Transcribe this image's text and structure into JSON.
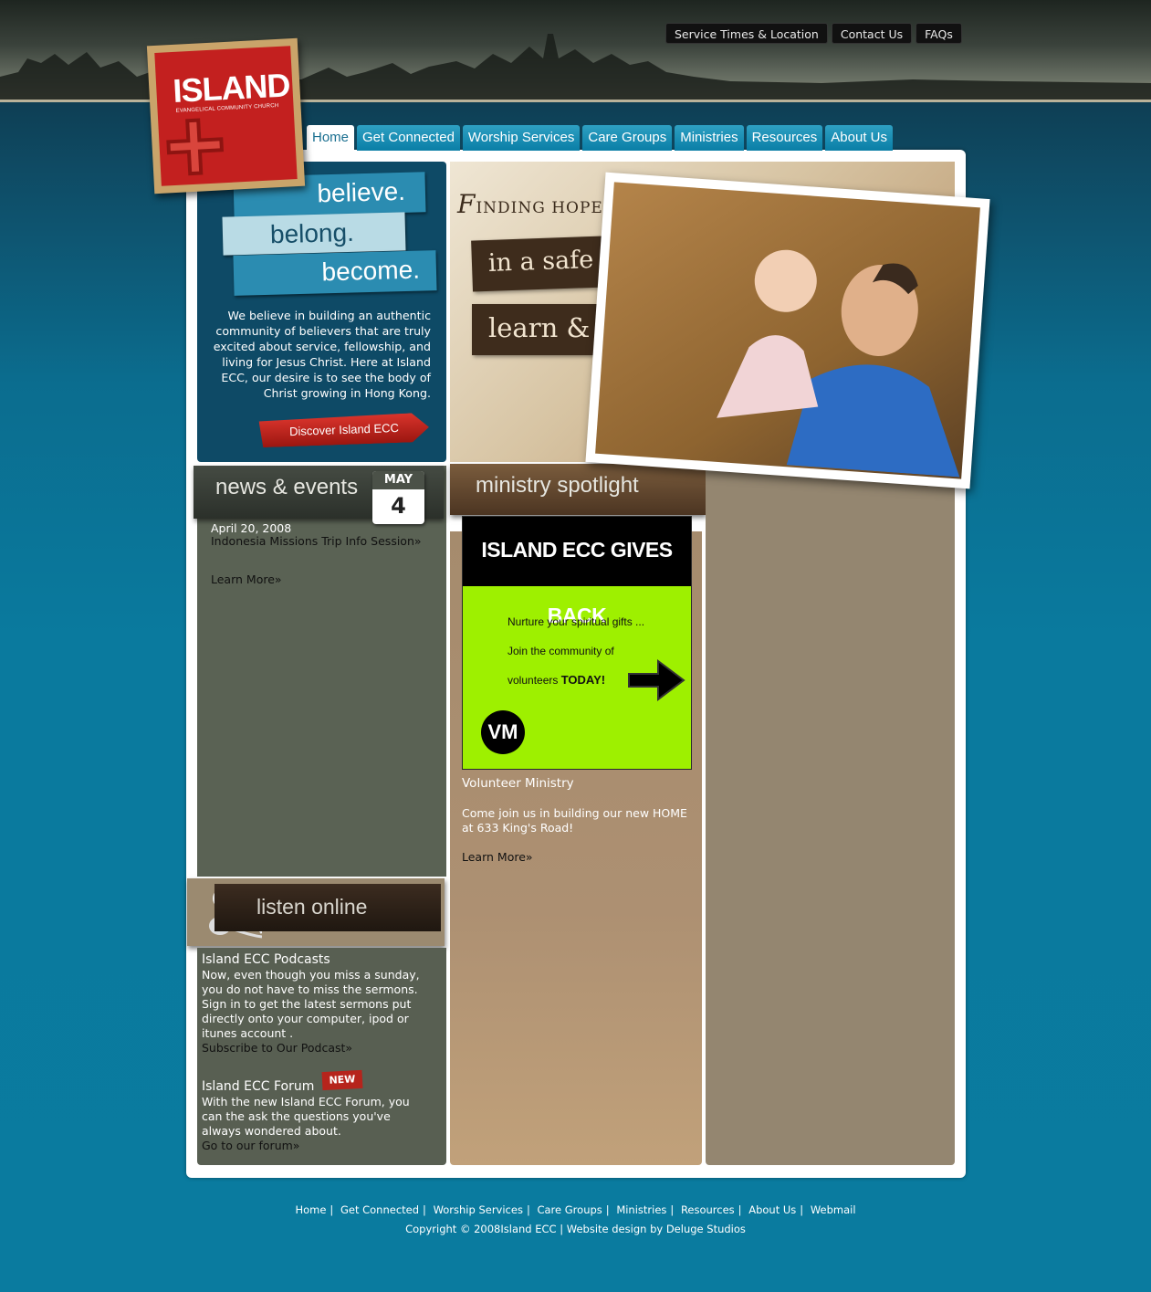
{
  "toplinks": [
    "Service Times & Location",
    "Contact Us",
    "FAQs"
  ],
  "logo": {
    "word": "ISLAND",
    "sub": "EVANGELICAL COMMUNITY CHURCH"
  },
  "nav": [
    "Home",
    "Get Connected",
    "Worship Services",
    "Care Groups",
    "Ministries",
    "Resources",
    "About Us"
  ],
  "believe": {
    "words": [
      "believe.",
      "belong.",
      "become."
    ],
    "text": "We believe in building an authentic community of believers that are truly excited about service, fellowship, and living for Jesus Christ. Here at Island ECC, our desire is to see the body of Christ growing in Hong Kong.",
    "button": "Discover Island ECC"
  },
  "hope": {
    "title_cap": "F",
    "title_rest": "INDING HOPE...",
    "line1": "in a safe place to",
    "line2": "learn & grow"
  },
  "news": {
    "heading": "news & events",
    "month": "MAY",
    "day": "4",
    "date": "April 20, 2008",
    "item": "Indonesia Missions Trip Info Session»",
    "learn_more": "Learn More»"
  },
  "ministry": {
    "heading": "ministry spotlight",
    "ad_head": "ISLAND ECC GIVES BACK",
    "ad_line1": "Nurture your spiritual gifts ...",
    "ad_line2": "Join the community of",
    "ad_line3": "volunteers",
    "ad_line3_bold": "TODAY!",
    "ad_logo": "VM",
    "title": "Volunteer Ministry",
    "text": "Come join us in building our new HOME at 633 King's Road!",
    "learn_more": "Learn More»"
  },
  "listen": {
    "heading": "listen online",
    "podcast_title": "Island ECC Podcasts",
    "podcast_text": "Now, even though you miss a sunday, you do not have to miss the sermons. Sign in to get the latest sermons put directly onto your computer, ipod or itunes account .",
    "podcast_link": "Subscribe to Our Podcast»",
    "forum_title": "Island ECC Forum",
    "new_badge": "NEW",
    "forum_text": "With the new Island ECC Forum, you can the ask the questions you've always wondered about.",
    "forum_link": "Go to our forum»"
  },
  "footer": {
    "links": [
      "Home",
      "Get Connected",
      "Worship Services",
      "Care Groups",
      "Ministries",
      "Resources",
      "About Us",
      "Webmail"
    ],
    "copyright": "Copyright © 2008Island ECC | Website design by Deluge Studios"
  }
}
